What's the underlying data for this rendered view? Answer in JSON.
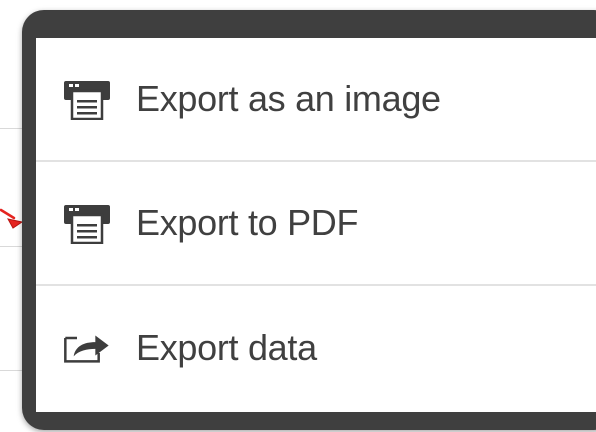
{
  "menu": {
    "items": [
      {
        "label": "Export as an image",
        "icon": "printer-icon"
      },
      {
        "label": "Export to PDF",
        "icon": "printer-icon"
      },
      {
        "label": "Export data",
        "icon": "share-arrow-icon"
      }
    ]
  },
  "colors": {
    "menu_frame": "#3f3f3f",
    "menu_body": "#ffffff",
    "label_text": "#404040",
    "divider": "#e2e2e2",
    "pointer_arrow": "#e52420"
  }
}
